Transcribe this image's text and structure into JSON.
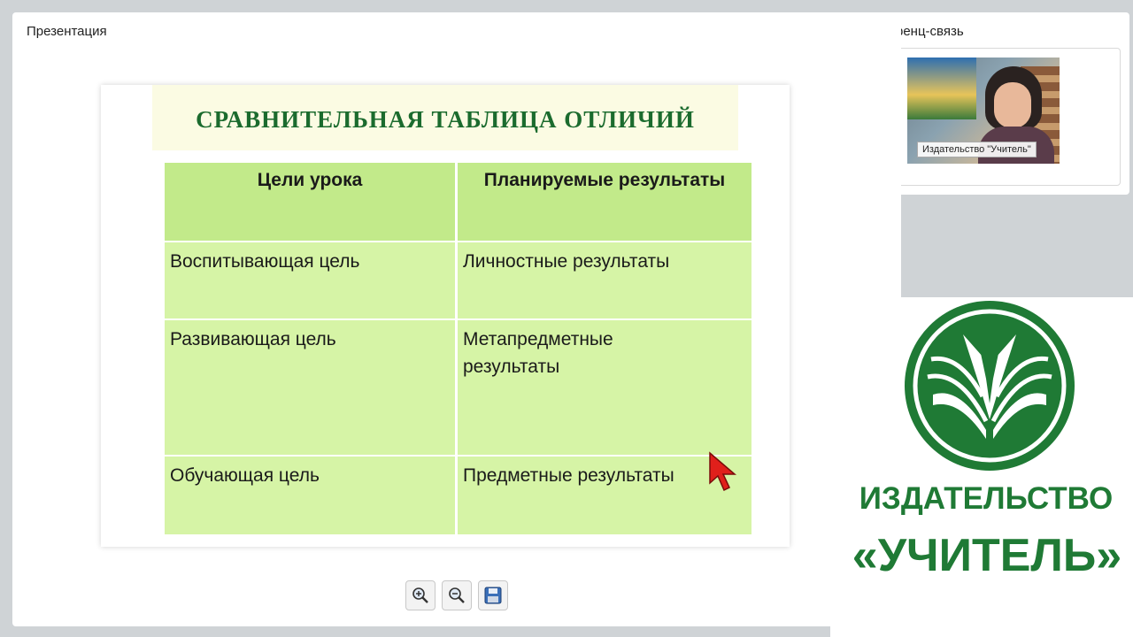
{
  "conference": {
    "title": "ренц-связь",
    "video_label": "Издательство \"Учитель\""
  },
  "presentation": {
    "window_title": "Презентация",
    "slide": {
      "heading": "СРАВНИТЕЛЬНАЯ ТАБЛИЦА ОТЛИЧИЙ",
      "columns": [
        "Цели урока",
        "Планируемые результаты"
      ],
      "rows": [
        [
          "Воспитывающая  цель",
          "Личностные результаты"
        ],
        [
          "Развивающая  цель",
          "Метапредметные результаты"
        ],
        [
          "Обучающая  цель",
          "Предметные результаты"
        ]
      ]
    },
    "toolbar": [
      {
        "name": "zoom-in-button",
        "icon": "zoom-in-icon"
      },
      {
        "name": "zoom-out-button",
        "icon": "zoom-out-icon"
      },
      {
        "name": "save-button",
        "icon": "save-icon"
      }
    ]
  },
  "logo": {
    "line1": "ИЗДАТЕЛЬСТВО",
    "line2": "«УЧИТЕЛЬ»",
    "color": "#1f7a35"
  }
}
